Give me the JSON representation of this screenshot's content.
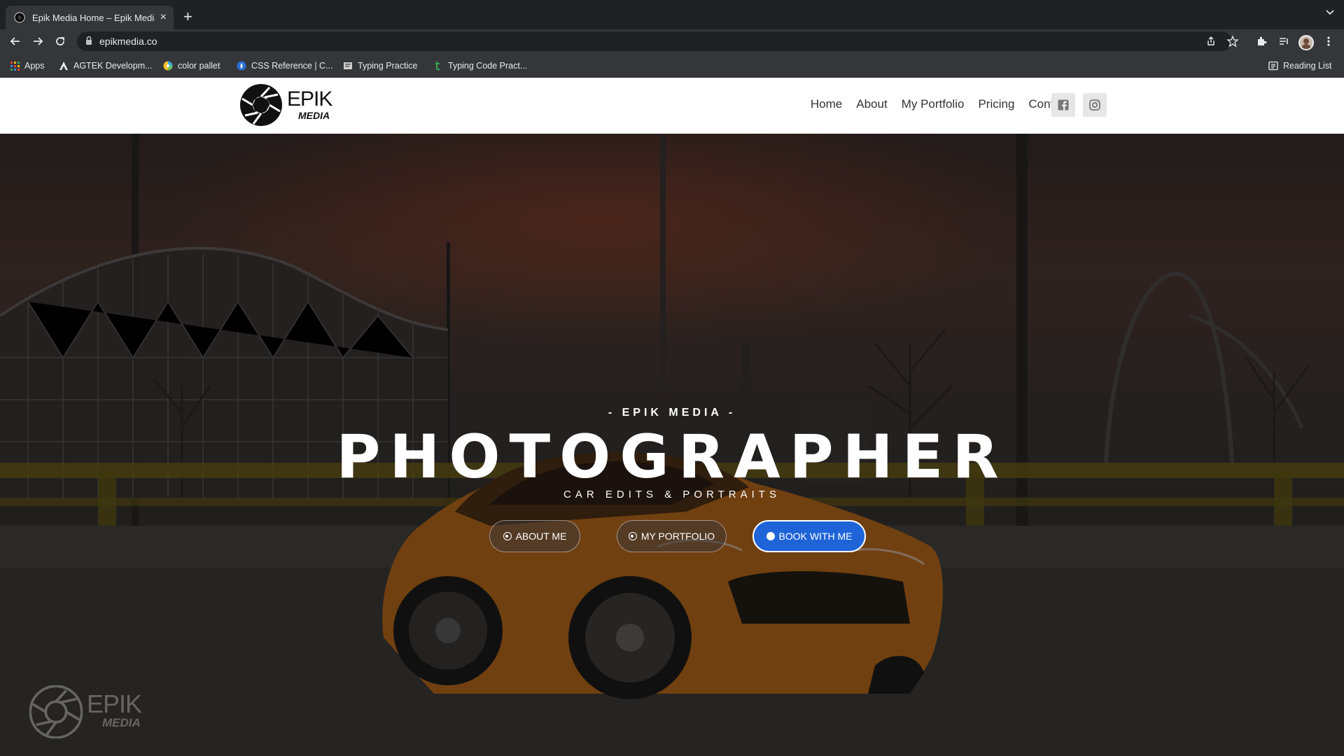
{
  "browser": {
    "tab_title": "Epik Media Home – Epik Media",
    "new_tab": "+",
    "url": "epikmedia.co",
    "reading_list": "Reading List",
    "bookmarks": [
      {
        "label": "Apps",
        "icon": "apps-grid-icon"
      },
      {
        "label": "AGTEK Developm...",
        "icon": "agtek-icon"
      },
      {
        "label": "color pallet",
        "icon": "color-wheel-icon"
      },
      {
        "label": "CSS Reference | C...",
        "icon": "css-reference-icon"
      },
      {
        "label": "Typing Practice",
        "icon": "typing-icon"
      },
      {
        "label": "Typing Code Pract...",
        "icon": "typing-code-icon"
      }
    ]
  },
  "site": {
    "logo": {
      "word": "EPIK",
      "sub": "MEDIA"
    },
    "nav": [
      "Home",
      "About",
      "My Portfolio",
      "Pricing",
      "Contact"
    ],
    "hero": {
      "kicker": "- EPIK MEDIA -",
      "headline": "PHOTOGRAPHER",
      "subline": "CAR EDITS & PORTRAITS",
      "buttons": {
        "about": "ABOUT ME",
        "portfolio": "MY PORTFOLIO",
        "book": "BOOK WITH ME"
      }
    },
    "watermark": {
      "word": "EPIK",
      "sub": "MEDIA"
    }
  },
  "colors": {
    "primary_button": "#1e64d8",
    "car": "#c8781a"
  }
}
